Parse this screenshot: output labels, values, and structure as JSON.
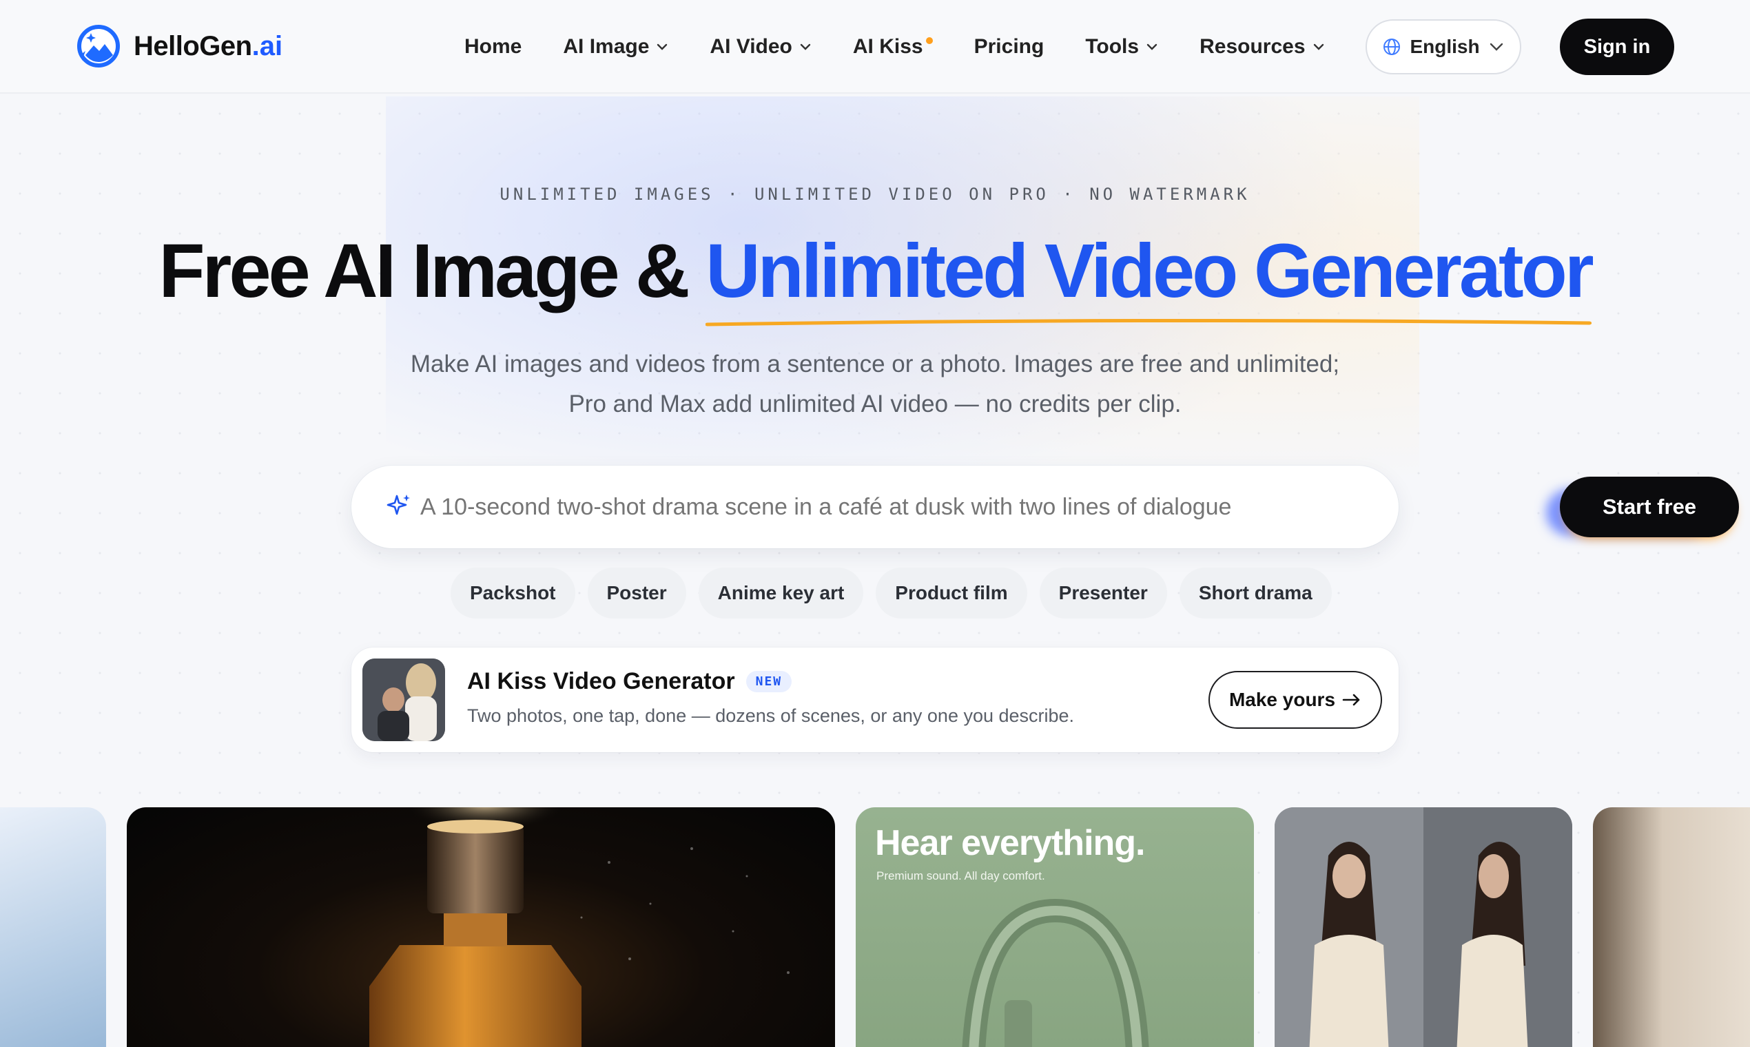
{
  "brand": {
    "name": "HelloGen",
    "tld": ".ai"
  },
  "nav": {
    "items": [
      {
        "label": "Home",
        "dropdown": false
      },
      {
        "label": "AI Image",
        "dropdown": true
      },
      {
        "label": "AI Video",
        "dropdown": true
      },
      {
        "label": "AI Kiss",
        "dropdown": false,
        "dot": true
      },
      {
        "label": "Pricing",
        "dropdown": false
      },
      {
        "label": "Tools",
        "dropdown": true
      },
      {
        "label": "Resources",
        "dropdown": true
      }
    ],
    "language": "English",
    "signin": "Sign in"
  },
  "hero": {
    "eyebrow": "UNLIMITED IMAGES · UNLIMITED VIDEO ON PRO · NO WATERMARK",
    "title_plain": "Free AI Image & ",
    "title_accent": "Unlimited Video Generator",
    "subtitle_line1": "Make AI images and videos from a sentence or a photo. Images are free and unlimited;",
    "subtitle_line2": "Pro and Max add unlimited AI video — no credits per clip."
  },
  "prompt": {
    "placeholder": "A 10-second two-shot drama scene in a café at dusk with two lines of dialogue",
    "button": "Start free"
  },
  "chips": [
    "Packshot",
    "Poster",
    "Anime key art",
    "Product film",
    "Presenter",
    "Short drama"
  ],
  "promo": {
    "title": "AI Kiss Video Generator",
    "badge": "NEW",
    "description": "Two photos, one tap, done — dozens of scenes, or any one you describe.",
    "button": "Make yours"
  },
  "gallery": {
    "headphones_headline": "Hear everything.",
    "headphones_sub": "Premium sound. All day comfort."
  },
  "colors": {
    "accent": "#1f56f0",
    "underline": "#f7a823",
    "dark_button": "#0b0b0d",
    "kiss_dot": "#ff9f1c"
  }
}
